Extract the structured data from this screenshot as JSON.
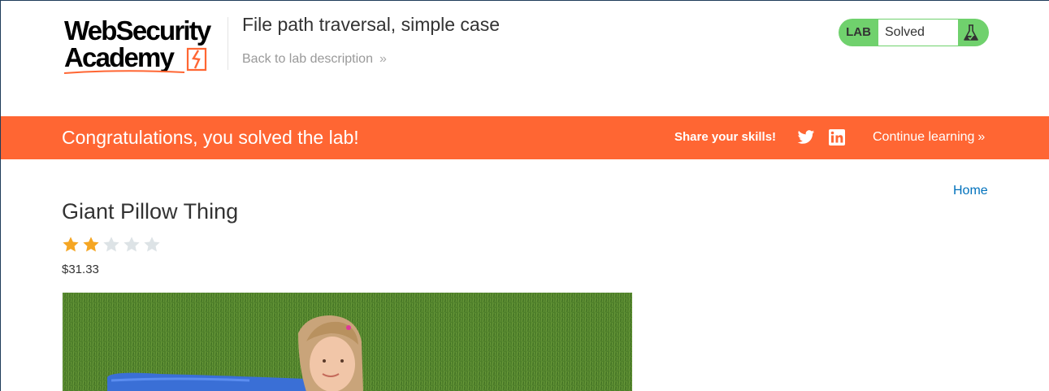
{
  "header": {
    "logo_line1": "WebSecurity",
    "logo_line2": "Academy",
    "lab_title": "File path traversal, simple case",
    "back_link": "Back to lab description",
    "back_chevron": "»"
  },
  "lab_status": {
    "tag": "LAB",
    "state": "Solved",
    "colors": {
      "badge": "#70d16d"
    },
    "icon": "flask-icon"
  },
  "banner": {
    "message": "Congratulations, you solved the lab!",
    "share_label": "Share your skills!",
    "continue_label": "Continue learning",
    "continue_chevron": "»",
    "colors": {
      "background": "#ff6633"
    }
  },
  "nav": {
    "home_label": "Home"
  },
  "product": {
    "title": "Giant Pillow Thing",
    "rating": 2,
    "rating_max": 5,
    "price": "$31.33",
    "image_description": "girl with blue inflatable on grass"
  },
  "colors": {
    "link": "#0071bc",
    "star_filled": "#f5a623",
    "star_empty": "#dde3e6"
  }
}
